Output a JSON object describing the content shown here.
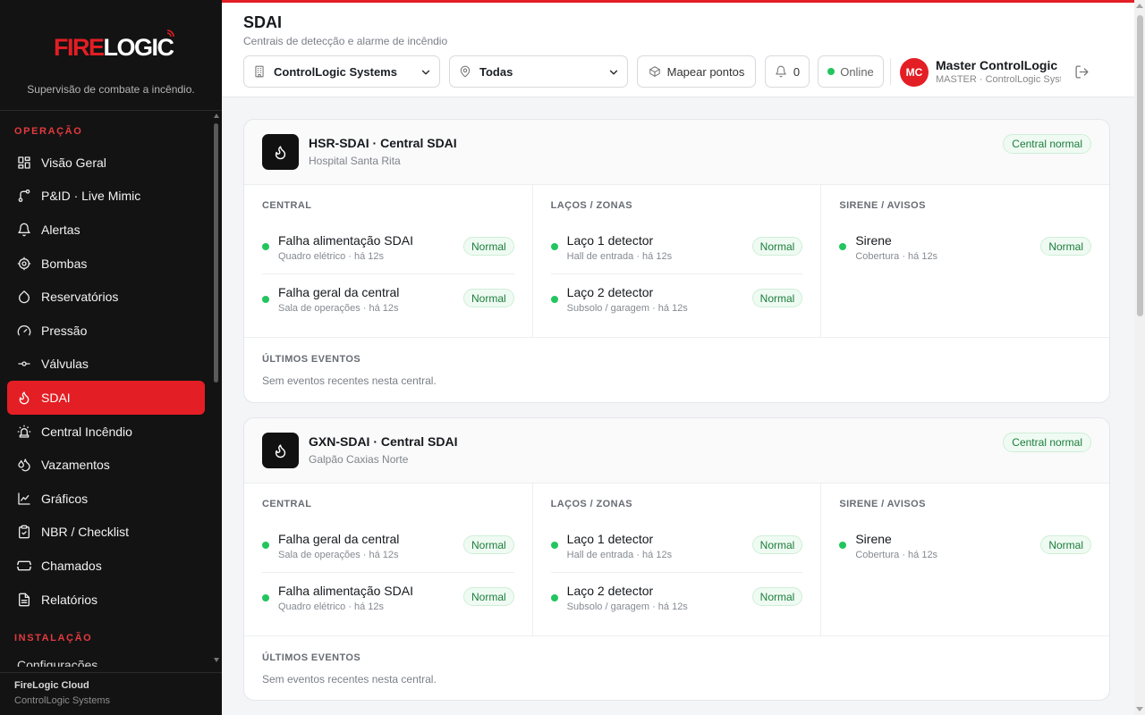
{
  "brand": {
    "logo_fire": "FIRE",
    "logo_logic": "LOGIC",
    "tagline": "Supervisão de combate a incêndio."
  },
  "sidebar": {
    "section_operacao": "OPERAÇÃO",
    "section_instalacao": "INSTALAÇÃO",
    "items": [
      {
        "label": "Visão Geral",
        "icon": "grid-icon"
      },
      {
        "label": "P&ID · Live Mimic",
        "icon": "flow-icon"
      },
      {
        "label": "Alertas",
        "icon": "bell-icon"
      },
      {
        "label": "Bombas",
        "icon": "pump-icon"
      },
      {
        "label": "Reservatórios",
        "icon": "drop-icon"
      },
      {
        "label": "Pressão",
        "icon": "gauge-icon"
      },
      {
        "label": "Válvulas",
        "icon": "valve-icon"
      },
      {
        "label": "SDAI",
        "icon": "flame-icon",
        "active": true
      },
      {
        "label": "Central Incêndio",
        "icon": "siren-icon"
      },
      {
        "label": "Vazamentos",
        "icon": "droplets-icon"
      },
      {
        "label": "Gráficos",
        "icon": "chart-line-icon"
      },
      {
        "label": "NBR / Checklist",
        "icon": "clipboard-icon"
      },
      {
        "label": "Chamados",
        "icon": "ticket-icon"
      },
      {
        "label": "Relatórios",
        "icon": "file-icon"
      }
    ],
    "partial_item": "Configurações",
    "footer_title": "FireLogic Cloud",
    "footer_sub": "ControlLogic Systems"
  },
  "header": {
    "title": "SDAI",
    "subtitle": "Centrais de detecção e alarme de incêndio",
    "company_select": "ControlLogic Systems",
    "region_select": "Todas",
    "map_button": "Mapear pontos",
    "notifications_count": "0",
    "status": "Online",
    "user_initials": "MC",
    "user_name": "Master ControlLogic",
    "user_role": "MASTER · ControlLogic Systems"
  },
  "labels": {
    "col_central": "CENTRAL",
    "col_lacos": "LAÇOS / ZONAS",
    "col_sirene": "SIRENE / AVISOS",
    "events_title": "ÚLTIMOS EVENTOS",
    "events_empty": "Sem eventos recentes nesta central.",
    "normal": "Normal"
  },
  "centrals": [
    {
      "title": "HSR-SDAI · Central SDAI",
      "site": "Hospital Santa Rita",
      "state": "Central normal",
      "central": [
        {
          "name": "Falha alimentação SDAI",
          "sub": "Quadro elétrico · há 12s",
          "status": "Normal"
        },
        {
          "name": "Falha geral da central",
          "sub": "Sala de operações · há 12s",
          "status": "Normal"
        }
      ],
      "lacos": [
        {
          "name": "Laço 1 detector",
          "sub": "Hall de entrada · há 12s",
          "status": "Normal"
        },
        {
          "name": "Laço 2 detector",
          "sub": "Subsolo / garagem · há 12s",
          "status": "Normal"
        }
      ],
      "sirene": [
        {
          "name": "Sirene",
          "sub": "Cobertura · há 12s",
          "status": "Normal"
        }
      ]
    },
    {
      "title": "GXN-SDAI · Central SDAI",
      "site": "Galpão Caxias Norte",
      "state": "Central normal",
      "central": [
        {
          "name": "Falha geral da central",
          "sub": "Sala de operações · há 12s",
          "status": "Normal"
        },
        {
          "name": "Falha alimentação SDAI",
          "sub": "Quadro elétrico · há 12s",
          "status": "Normal"
        }
      ],
      "lacos": [
        {
          "name": "Laço 1 detector",
          "sub": "Hall de entrada · há 12s",
          "status": "Normal"
        },
        {
          "name": "Laço 2 detector",
          "sub": "Subsolo / garagem · há 12s",
          "status": "Normal"
        }
      ],
      "sirene": [
        {
          "name": "Sirene",
          "sub": "Cobertura · há 12s",
          "status": "Normal"
        }
      ]
    }
  ],
  "colors": {
    "brand_red": "#e31e24",
    "sidebar_bg": "#131313",
    "ok_green": "#22c55e",
    "badge_text": "#1c7c3d"
  }
}
